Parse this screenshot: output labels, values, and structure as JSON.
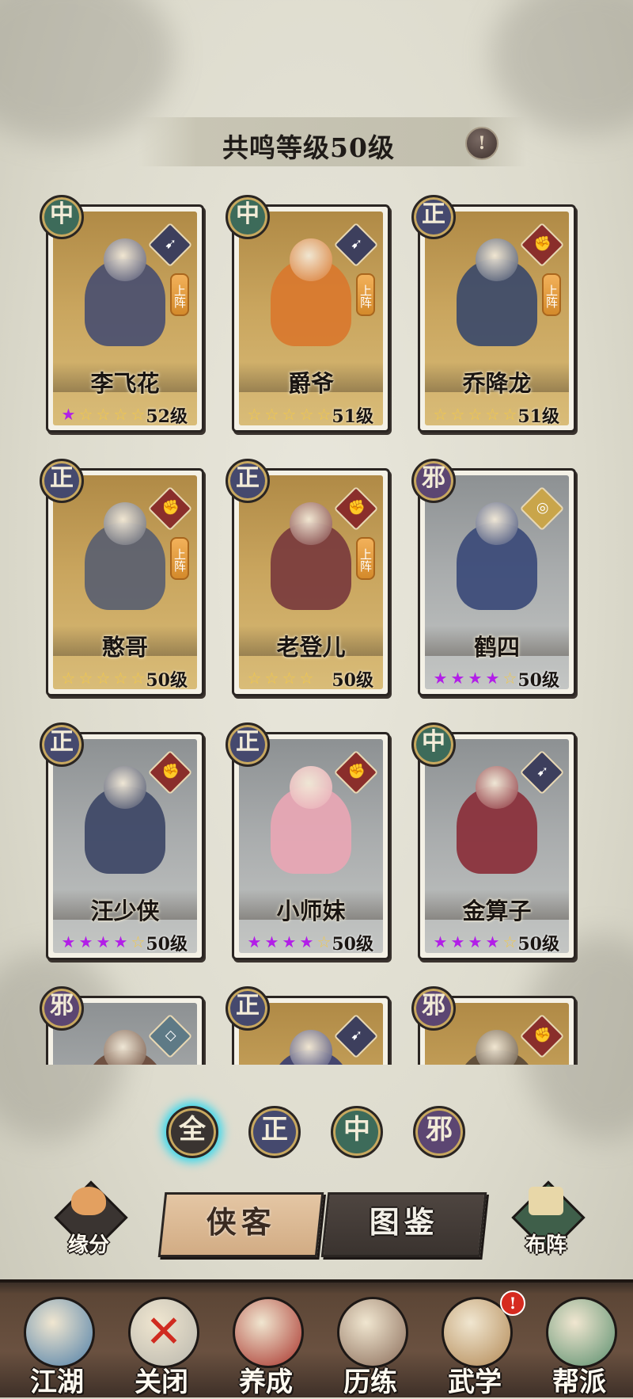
{
  "header": {
    "title": "共鸣等级50级",
    "info_icon": "exclamation-icon"
  },
  "cards": [
    {
      "name": "李飞花",
      "faction": "中",
      "faction_key": "zhong",
      "weapon": "spear",
      "deployed": true,
      "stars_on": 1,
      "stars_total": 5,
      "level": "52级",
      "bg": "gold",
      "tint": "#4a4f70"
    },
    {
      "name": "爵爷",
      "faction": "中",
      "faction_key": "zhong",
      "weapon": "spear",
      "deployed": true,
      "stars_on": 0,
      "stars_total": 5,
      "level": "51级",
      "bg": "gold",
      "tint": "#d9782e"
    },
    {
      "name": "乔降龙",
      "faction": "正",
      "faction_key": "zheng",
      "weapon": "fist",
      "deployed": true,
      "stars_on": 0,
      "stars_total": 5,
      "level": "51级",
      "bg": "gold",
      "tint": "#3c4a6a"
    },
    {
      "name": "憨哥",
      "faction": "正",
      "faction_key": "zheng",
      "weapon": "fist",
      "deployed": true,
      "stars_on": 0,
      "stars_total": 5,
      "level": "50级",
      "bg": "gold",
      "tint": "#5a5f70"
    },
    {
      "name": "老登儿",
      "faction": "正",
      "faction_key": "zheng",
      "weapon": "fist",
      "deployed": true,
      "stars_on": 0,
      "stars_total": 4,
      "level": "50级",
      "bg": "gold",
      "tint": "#7a3b3d"
    },
    {
      "name": "鹤四",
      "faction": "邪",
      "faction_key": "xie",
      "weapon": "swirl",
      "deployed": false,
      "stars_on": 4,
      "stars_total": 5,
      "level": "50级",
      "bg": "gray",
      "tint": "#3b4a78"
    },
    {
      "name": "汪少侠",
      "faction": "正",
      "faction_key": "zheng",
      "weapon": "fist",
      "deployed": false,
      "stars_on": 4,
      "stars_total": 5,
      "level": "50级",
      "bg": "gray",
      "tint": "#3d4766"
    },
    {
      "name": "小师妹",
      "faction": "正",
      "faction_key": "zheng",
      "weapon": "fist",
      "deployed": false,
      "stars_on": 4,
      "stars_total": 5,
      "level": "50级",
      "bg": "gray",
      "tint": "#e8a6b4"
    },
    {
      "name": "金算子",
      "faction": "中",
      "faction_key": "zhong",
      "weapon": "spear",
      "deployed": false,
      "stars_on": 4,
      "stars_total": 5,
      "level": "50级",
      "bg": "gray",
      "tint": "#8a2f3a"
    },
    {
      "name": "",
      "faction": "邪",
      "faction_key": "xie",
      "weapon": "shield",
      "deployed": false,
      "stars_on": 0,
      "stars_total": 0,
      "level": "",
      "bg": "gray",
      "tint": "#6b4a3a"
    },
    {
      "name": "",
      "faction": "正",
      "faction_key": "zheng",
      "weapon": "spear",
      "deployed": false,
      "stars_on": 0,
      "stars_total": 0,
      "level": "",
      "bg": "gold",
      "tint": "#3b3f72"
    },
    {
      "name": "",
      "faction": "邪",
      "faction_key": "xie",
      "weapon": "fist",
      "deployed": false,
      "stars_on": 0,
      "stars_total": 0,
      "level": "",
      "bg": "gold",
      "tint": "#5a4a3a"
    }
  ],
  "deploy_label": "上阵",
  "filters": [
    {
      "label": "全",
      "key": "all",
      "selected": true
    },
    {
      "label": "正",
      "key": "zheng",
      "selected": false
    },
    {
      "label": "中",
      "key": "zhong",
      "selected": false
    },
    {
      "label": "邪",
      "key": "xie",
      "selected": false
    }
  ],
  "actions": {
    "fate_label": "缘分",
    "hero_tab": "侠客",
    "catalog_tab": "图鉴",
    "formation_label": "布阵",
    "active_tab": "hero"
  },
  "nav": [
    {
      "label": "江湖",
      "icon": "map-scroll-icon",
      "color": "#4f7fa8"
    },
    {
      "label": "关闭",
      "icon": "close-icon",
      "color": "#b9b7ad"
    },
    {
      "label": "养成",
      "icon": "gourd-icon",
      "color": "#a8322a"
    },
    {
      "label": "历练",
      "icon": "sword-icon",
      "color": "#8b6d5a"
    },
    {
      "label": "武学",
      "icon": "book-icon",
      "color": "#b38955",
      "badge": "!"
    },
    {
      "label": "帮派",
      "icon": "emblem-icon",
      "color": "#5a8f6e"
    }
  ]
}
